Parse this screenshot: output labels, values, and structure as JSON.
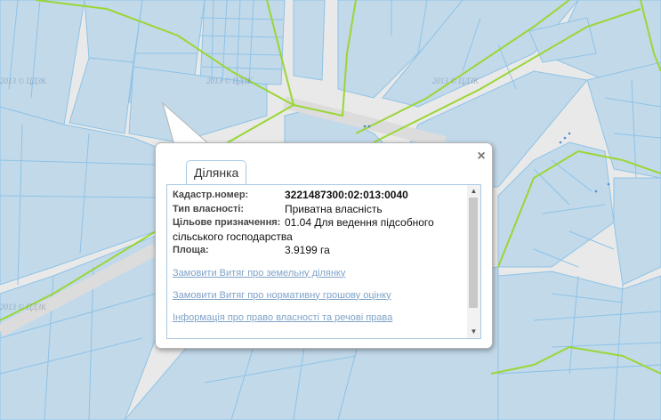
{
  "watermark": "2013 © ЦДЗК",
  "popup": {
    "tab_label": "Ділянка",
    "close_label": "×",
    "fields": [
      {
        "label": "Кадастр.номер:",
        "value": "3221487300:02:013:0040",
        "bold": true
      },
      {
        "label": "Тип власності:",
        "value": "Приватна власність"
      },
      {
        "label": "Цільове призначення:",
        "value": "01.04 Для ведення підсобного"
      },
      {
        "label": "",
        "value": "сільського господарства"
      },
      {
        "label": "Площа:",
        "value": "3.9199 га"
      }
    ],
    "links": [
      "Замовити Витяг про земельну ділянку",
      "Замовити Витяг про нормативну грошову оцінку",
      "Інформація про право власності та речові права"
    ]
  }
}
